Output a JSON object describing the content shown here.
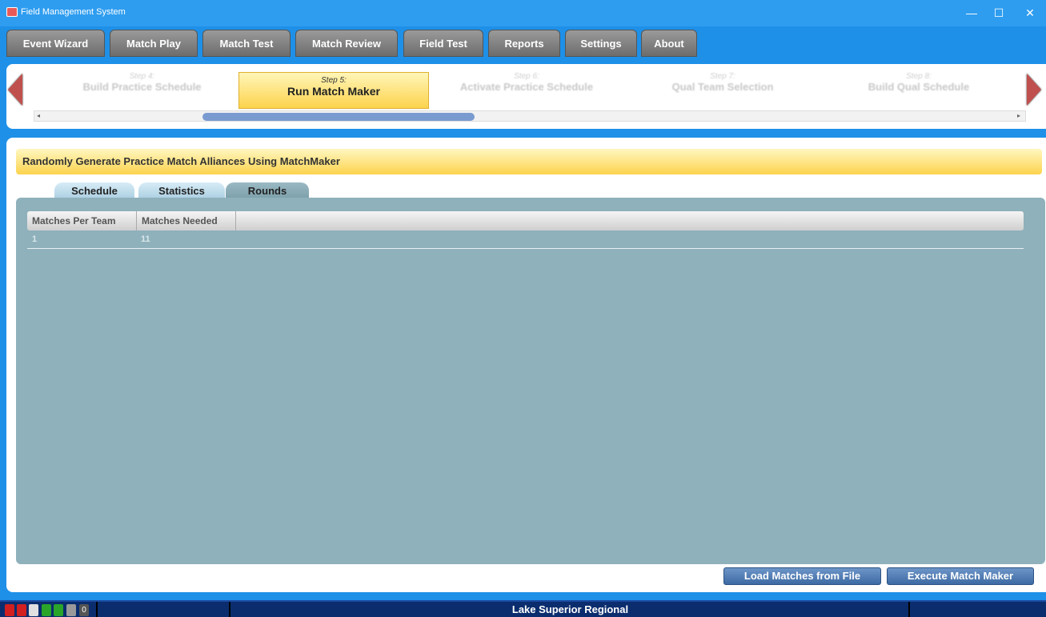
{
  "window": {
    "title": "Field Management System",
    "minimize": "—",
    "maximize": "☐",
    "close": "✕"
  },
  "nav": {
    "tabs": [
      {
        "label": "Event Wizard"
      },
      {
        "label": "Match Play"
      },
      {
        "label": "Match Test"
      },
      {
        "label": "Match Review"
      },
      {
        "label": "Field Test"
      },
      {
        "label": "Reports"
      },
      {
        "label": "Settings"
      },
      {
        "label": "About"
      }
    ]
  },
  "wizard": {
    "steps": [
      {
        "num": "Step 4:",
        "name": "Build Practice Schedule"
      },
      {
        "num": "Step 5:",
        "name": "Run Match Maker"
      },
      {
        "num": "Step 6:",
        "name": "Activate Practice Schedule"
      },
      {
        "num": "Step 7:",
        "name": "Qual Team Selection"
      },
      {
        "num": "Step 8:",
        "name": "Build Qual Schedule"
      }
    ],
    "active_step_index": 1,
    "scroll_left_glyph": "◂",
    "scroll_right_glyph": "▸"
  },
  "main": {
    "banner": "Randomly Generate Practice Match Alliances Using MatchMaker",
    "tabs": [
      {
        "label": "Schedule"
      },
      {
        "label": "Statistics"
      },
      {
        "label": "Rounds"
      }
    ],
    "active_tab": "Rounds",
    "grid": {
      "columns": [
        "Matches Per Team",
        "Matches Needed"
      ],
      "rows": [
        [
          "1",
          "11"
        ]
      ]
    },
    "buttons": {
      "load": "Load Matches from File",
      "execute": "Execute Match Maker"
    }
  },
  "status": {
    "event_name": "Lake Superior Regional",
    "indicator_count": "0",
    "indicator_colors": [
      "#d21f1f",
      "#d21f1f",
      "#e0e0e0",
      "#2aa52a",
      "#2aa52a",
      "#9a9a9a"
    ]
  }
}
